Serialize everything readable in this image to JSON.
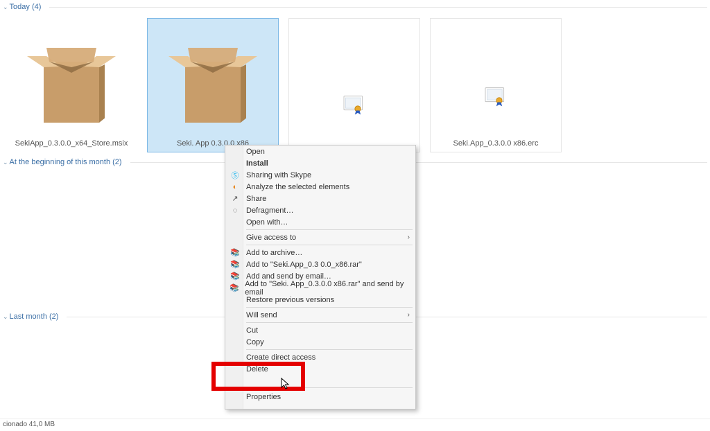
{
  "groups": {
    "today": {
      "label": "Today (4)"
    },
    "month_begin": {
      "label": "At the beginning of this month (2)"
    },
    "last_month": {
      "label": "Last month (2)"
    }
  },
  "files": {
    "f1": {
      "name": "SekiApp_0.3.0.0_x64_Store.msix"
    },
    "f2": {
      "name": "Seki. App 0.3.0.0 x86"
    },
    "f3": {
      "name": ""
    },
    "f4": {
      "name": "Seki.App_0.3.0.0 x86.erc"
    }
  },
  "context_menu": {
    "open": "Open",
    "install": "Install",
    "sharing_skype": "Sharing with Skype",
    "analyze": "Analyze the selected elements",
    "share": "Share",
    "defragment": "Defragment…",
    "open_with": "Open with…",
    "give_access": "Give access to",
    "add_archive": "Add to archive…",
    "add_rar1": "Add to \"Seki.App_0.3 0.0_x86.rar\"",
    "add_send_email": "Add and send by email…",
    "add_rar_send": "Add to \"Seki. App_0.3.0.0 x86.rar\" and send by email",
    "restore_prev": "Restore previous versions",
    "will_send": "Will send",
    "cut": "Cut",
    "copy": "Copy",
    "create_direct": "Create direct access",
    "delete": "Delete",
    "properties": "Properties"
  },
  "status": "cionado 41,0 MB"
}
